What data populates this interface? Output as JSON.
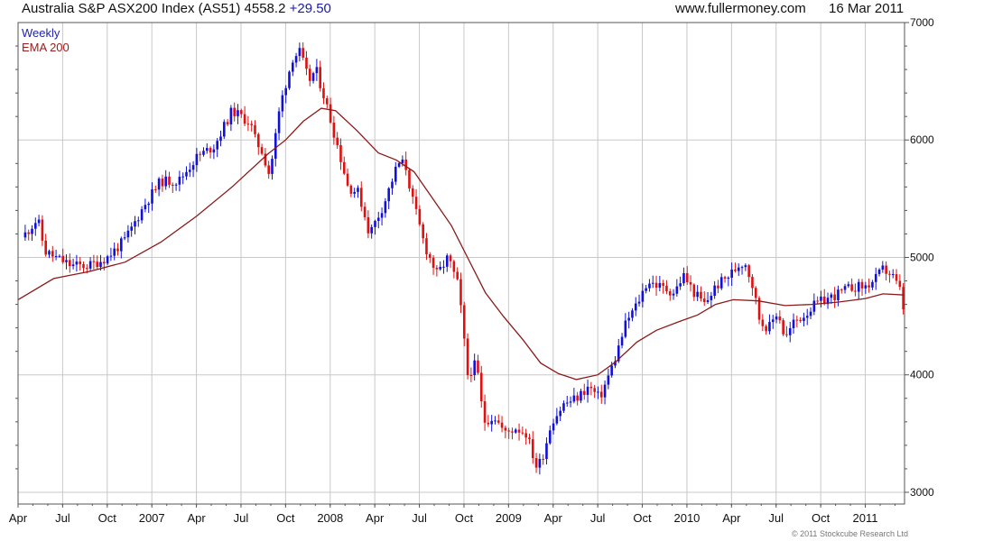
{
  "header": {
    "title": "Australia S&P ASX200 Index (AS51) 4558.2",
    "change": "+29.50",
    "website": "www.fullermoney.com",
    "date": "16 Mar 2011"
  },
  "legend": {
    "series1": "Weekly",
    "series2": "EMA 200"
  },
  "copyright": "© 2011 Stockcube Research Ltd",
  "colors": {
    "up": "#1010d8",
    "down": "#e01010",
    "ema": "#8b1a1a",
    "grid": "#c8c8c8",
    "frame": "#555555"
  },
  "chart_data": {
    "type": "candlestick",
    "ylim": [
      2900,
      7000
    ],
    "yticks": [
      3000,
      4000,
      5000,
      6000,
      7000
    ],
    "grid": true,
    "legend_position": "top-left",
    "xtick_labels": [
      "Apr",
      "Jul",
      "Oct",
      "2007",
      "Apr",
      "Jul",
      "Oct",
      "2008",
      "Apr",
      "Jul",
      "Oct",
      "2009",
      "Apr",
      "Jul",
      "Oct",
      "2010",
      "Apr",
      "Jul",
      "Oct",
      "2011"
    ],
    "close_path": [
      [
        2006.29,
        5200
      ],
      [
        2006.36,
        5330
      ],
      [
        2006.4,
        5050
      ],
      [
        2006.46,
        5000
      ],
      [
        2006.55,
        4930
      ],
      [
        2006.65,
        4930
      ],
      [
        2006.75,
        5000
      ],
      [
        2006.85,
        5150
      ],
      [
        2006.96,
        5450
      ],
      [
        2007.05,
        5650
      ],
      [
        2007.15,
        5650
      ],
      [
        2007.25,
        5850
      ],
      [
        2007.35,
        5950
      ],
      [
        2007.45,
        6250
      ],
      [
        2007.55,
        6150
      ],
      [
        2007.58,
        6000
      ],
      [
        2007.62,
        5900
      ],
      [
        2007.66,
        5700
      ],
      [
        2007.72,
        6300
      ],
      [
        2007.79,
        6700
      ],
      [
        2007.83,
        6750
      ],
      [
        2007.88,
        6500
      ],
      [
        2007.92,
        6600
      ],
      [
        2007.97,
        6350
      ],
      [
        2008.05,
        5900
      ],
      [
        2008.1,
        5600
      ],
      [
        2008.16,
        5550
      ],
      [
        2008.22,
        5200
      ],
      [
        2008.3,
        5450
      ],
      [
        2008.38,
        5800
      ],
      [
        2008.42,
        5800
      ],
      [
        2008.46,
        5500
      ],
      [
        2008.53,
        5100
      ],
      [
        2008.6,
        4850
      ],
      [
        2008.66,
        5000
      ],
      [
        2008.72,
        4750
      ],
      [
        2008.77,
        4000
      ],
      [
        2008.82,
        4100
      ],
      [
        2008.86,
        3600
      ],
      [
        2008.92,
        3650
      ],
      [
        2008.98,
        3500
      ],
      [
        2009.04,
        3550
      ],
      [
        2009.1,
        3500
      ],
      [
        2009.16,
        3200
      ],
      [
        2009.2,
        3350
      ],
      [
        2009.24,
        3600
      ],
      [
        2009.31,
        3750
      ],
      [
        2009.38,
        3800
      ],
      [
        2009.45,
        3900
      ],
      [
        2009.51,
        3800
      ],
      [
        2009.55,
        3950
      ],
      [
        2009.6,
        4150
      ],
      [
        2009.66,
        4450
      ],
      [
        2009.72,
        4600
      ],
      [
        2009.78,
        4800
      ],
      [
        2009.85,
        4750
      ],
      [
        2009.93,
        4700
      ],
      [
        2009.98,
        4850
      ],
      [
        2010.04,
        4700
      ],
      [
        2010.1,
        4600
      ],
      [
        2010.16,
        4750
      ],
      [
        2010.24,
        4850
      ],
      [
        2010.3,
        4950
      ],
      [
        2010.33,
        4950
      ],
      [
        2010.37,
        4750
      ],
      [
        2010.41,
        4450
      ],
      [
        2010.46,
        4400
      ],
      [
        2010.51,
        4550
      ],
      [
        2010.55,
        4300
      ],
      [
        2010.6,
        4450
      ],
      [
        2010.65,
        4500
      ],
      [
        2010.72,
        4600
      ],
      [
        2010.79,
        4650
      ],
      [
        2010.86,
        4700
      ],
      [
        2010.93,
        4750
      ],
      [
        2011.0,
        4750
      ],
      [
        2011.05,
        4800
      ],
      [
        2011.1,
        4900
      ],
      [
        2011.15,
        4850
      ],
      [
        2011.2,
        4700
      ],
      [
        2011.21,
        4558
      ]
    ],
    "ema_series": {
      "name": "EMA 200",
      "points": [
        [
          2006.25,
          4640
        ],
        [
          2006.45,
          4820
        ],
        [
          2006.65,
          4880
        ],
        [
          2006.85,
          4960
        ],
        [
          2007.05,
          5130
        ],
        [
          2007.25,
          5350
        ],
        [
          2007.45,
          5600
        ],
        [
          2007.65,
          5880
        ],
        [
          2007.75,
          6000
        ],
        [
          2007.85,
          6160
        ],
        [
          2007.95,
          6270
        ],
        [
          2008.03,
          6250
        ],
        [
          2008.15,
          6080
        ],
        [
          2008.27,
          5890
        ],
        [
          2008.37,
          5830
        ],
        [
          2008.47,
          5730
        ],
        [
          2008.58,
          5490
        ],
        [
          2008.68,
          5270
        ],
        [
          2008.77,
          5000
        ],
        [
          2008.87,
          4700
        ],
        [
          2008.97,
          4500
        ],
        [
          2009.08,
          4300
        ],
        [
          2009.18,
          4100
        ],
        [
          2009.28,
          4010
        ],
        [
          2009.38,
          3960
        ],
        [
          2009.5,
          4000
        ],
        [
          2009.6,
          4110
        ],
        [
          2009.72,
          4280
        ],
        [
          2009.83,
          4380
        ],
        [
          2009.95,
          4450
        ],
        [
          2010.06,
          4510
        ],
        [
          2010.16,
          4600
        ],
        [
          2010.26,
          4640
        ],
        [
          2010.4,
          4630
        ],
        [
          2010.55,
          4590
        ],
        [
          2010.7,
          4600
        ],
        [
          2010.85,
          4620
        ],
        [
          2011.0,
          4650
        ],
        [
          2011.1,
          4690
        ],
        [
          2011.22,
          4680
        ]
      ]
    }
  }
}
